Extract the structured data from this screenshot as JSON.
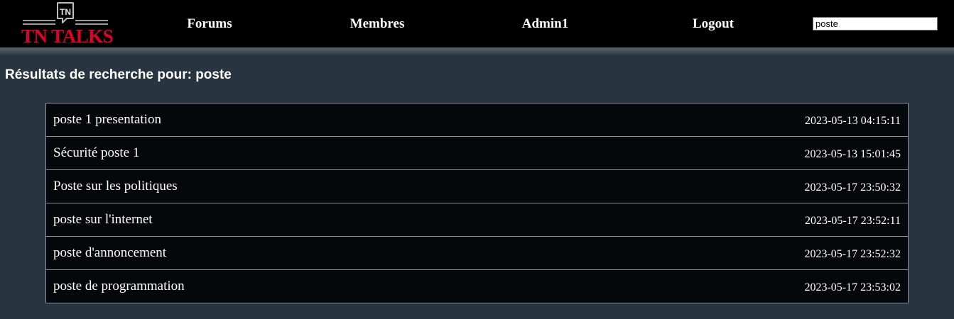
{
  "logo": {
    "badge_text": "TN",
    "wordmark": "TN TALKS",
    "color": "#e0002a"
  },
  "nav": {
    "forums": "Forums",
    "membres": "Membres",
    "user": "Admin1",
    "logout": "Logout"
  },
  "search": {
    "value": "poste"
  },
  "page_title": "Résultats de recherche pour: poste",
  "results": [
    {
      "title": "poste 1 presentation",
      "date": "2023-05-13 04:15:11"
    },
    {
      "title": "Sécurité poste 1",
      "date": "2023-05-13 15:01:45"
    },
    {
      "title": "Poste sur les politiques",
      "date": "2023-05-17 23:50:32"
    },
    {
      "title": "poste sur l'internet",
      "date": "2023-05-17 23:52:11"
    },
    {
      "title": "poste d'annoncement",
      "date": "2023-05-17 23:52:32"
    },
    {
      "title": "poste de programmation",
      "date": "2023-05-17 23:53:02"
    }
  ],
  "colors": {
    "header_bg": "#000000",
    "page_bg": "#28343f",
    "row_bg": "#05080b",
    "row_border": "#8a93a8"
  }
}
